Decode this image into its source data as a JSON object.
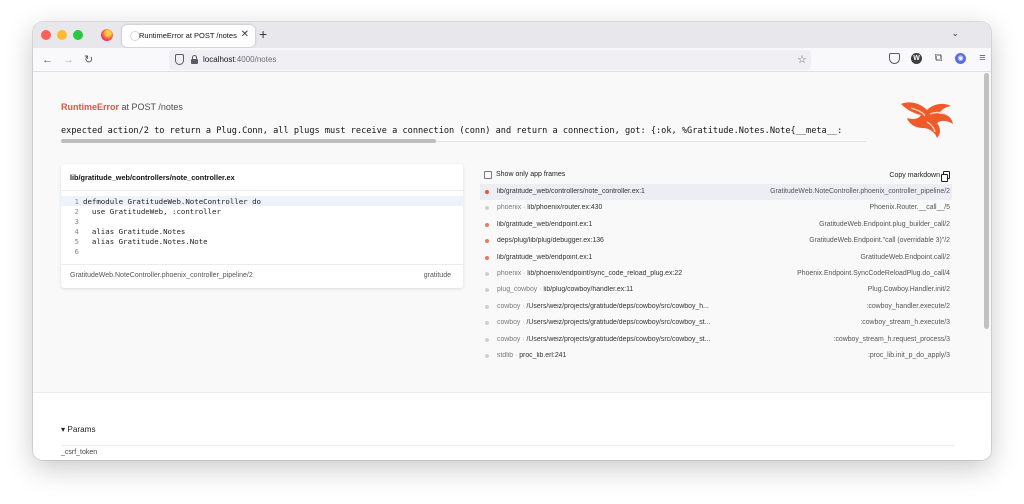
{
  "browser": {
    "tab": {
      "title": "RuntimeError at POST /notes",
      "close": "✕"
    },
    "new_tab": "+",
    "tab_list": "⌄",
    "nav": {
      "back": "←",
      "forward": "→",
      "reload": "↻"
    },
    "url": {
      "host": "localhost",
      "rest": ":4000/notes"
    },
    "bookmark": "☆",
    "toolbar": {
      "pocket": "",
      "profile": "W",
      "extensions": "⧉",
      "account": "◉",
      "menu": "≡"
    }
  },
  "error": {
    "exception": "RuntimeError",
    "at": " at POST /notes",
    "message": "expected action/2 to return a Plug.Conn, all plugs must receive a connection (conn) and return a connection, got: {:ok, %Gratitude.Notes.Note{__meta__:"
  },
  "code_card": {
    "file": "lib/gratitude_web/controllers/note_controller.ex",
    "lines": [
      {
        "num": "1",
        "code": "defmodule GratitudeWeb.NoteController do",
        "highlight": true
      },
      {
        "num": "2",
        "code": "  use GratitudeWeb, :controller",
        "highlight": false
      },
      {
        "num": "3",
        "code": "",
        "highlight": false
      },
      {
        "num": "4",
        "code": "  alias Gratitude.Notes",
        "highlight": false
      },
      {
        "num": "5",
        "code": "  alias Gratitude.Notes.Note",
        "highlight": false
      },
      {
        "num": "6",
        "code": "",
        "highlight": false
      }
    ],
    "function": "GratitudeWeb.NoteController.phoenix_controller_pipeline/2",
    "app": "gratitude"
  },
  "stacktrace": {
    "show_only_label": "Show only app frames",
    "copy_label": "Copy markdown",
    "frames": [
      {
        "app": "",
        "file": "lib/gratitude_web/controllers/note_controller.ex:1",
        "func": "GratitudeWeb.NoteController.phoenix_controller_pipeline/2",
        "is_app": true,
        "selected": true
      },
      {
        "app": "phoenix",
        "file": "lib/phoenix/router.ex:430",
        "func": "Phoenix.Router.__call__/5",
        "is_app": false,
        "selected": false
      },
      {
        "app": "",
        "file": "lib/gratitude_web/endpoint.ex:1",
        "func": "GratitudeWeb.Endpoint.plug_builder_call/2",
        "is_app": true,
        "selected": false
      },
      {
        "app": "",
        "file": "deps/plug/lib/plug/debugger.ex:136",
        "func": "GratitudeWeb.Endpoint.\"call (overridable 3)\"/2",
        "is_app": true,
        "selected": false
      },
      {
        "app": "",
        "file": "lib/gratitude_web/endpoint.ex:1",
        "func": "GratitudeWeb.Endpoint.call/2",
        "is_app": true,
        "selected": false
      },
      {
        "app": "phoenix",
        "file": "lib/phoenix/endpoint/sync_code_reload_plug.ex:22",
        "func": "Phoenix.Endpoint.SyncCodeReloadPlug.do_call/4",
        "is_app": false,
        "selected": false
      },
      {
        "app": "plug_cowboy",
        "file": "lib/plug/cowboy/handler.ex:11",
        "func": "Plug.Cowboy.Handler.init/2",
        "is_app": false,
        "selected": false
      },
      {
        "app": "cowboy",
        "file": "/Users/weiz/projects/gratitude/deps/cowboy/src/cowboy_h...",
        "func": ":cowboy_handler.execute/2",
        "is_app": false,
        "selected": false
      },
      {
        "app": "cowboy",
        "file": "/Users/weiz/projects/gratitude/deps/cowboy/src/cowboy_st...",
        "func": ":cowboy_stream_h.execute/3",
        "is_app": false,
        "selected": false
      },
      {
        "app": "cowboy",
        "file": "/Users/weiz/projects/gratitude/deps/cowboy/src/cowboy_st...",
        "func": ":cowboy_stream_h.request_process/3",
        "is_app": false,
        "selected": false
      },
      {
        "app": "stdlib",
        "file": "proc_lib.erl:241",
        "func": ":proc_lib.init_p_do_apply/3",
        "is_app": false,
        "selected": false
      }
    ]
  },
  "params": {
    "title": "▾ Params",
    "keys": [
      "_csrf_token"
    ]
  }
}
